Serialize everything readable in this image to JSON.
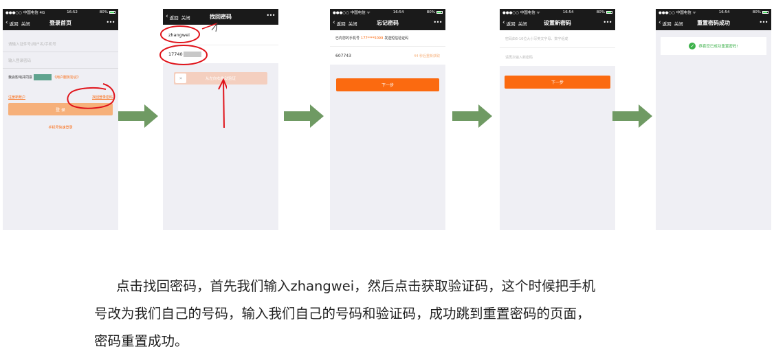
{
  "screens": {
    "login": {
      "status": {
        "carrier": "●●●○○ 中国电信 4G",
        "time": "16:52",
        "right": "80%"
      },
      "nav": {
        "back": "返回",
        "close": "关闭",
        "title": "登录首页",
        "more": "•••"
      },
      "username_placeholder": "请输入证件号/用户名/手机号",
      "password_placeholder": "输入登录密码",
      "agree_text": "我会影响并同意",
      "agree_link": "《用户服务协议》",
      "register_link": "注册新账户",
      "forgot_link": "找回登录密码",
      "login_button": "登 录",
      "quick_login": "手机号快速登录"
    },
    "find": {
      "nav": {
        "back": "返回",
        "close": "关闭",
        "title": "找回密码",
        "more": "•••"
      },
      "username_value": "zhangwei",
      "phone_value": "17740",
      "slider_label": "从左向右拖动验证",
      "slider_handle": "»"
    },
    "forget": {
      "status": {
        "carrier": "●●●○○ 中国电信 ᯤ",
        "time": "16:54",
        "right": "80%"
      },
      "nav": {
        "back": "返回",
        "close": "关闭",
        "title": "忘记密码",
        "more": "•••"
      },
      "sent_prefix": "已向您的手机号",
      "sent_phone": "177****5099",
      "sent_suffix": "发送短信验证码",
      "code_value": "607743",
      "resend": "44 秒后重新获取",
      "next_button": "下一步"
    },
    "setpwd": {
      "status": {
        "carrier": "●●●○○ 中国电信 ᯤ",
        "time": "16:54",
        "right": "80%"
      },
      "nav": {
        "back": "返回",
        "close": "关闭",
        "title": "设置新密码",
        "more": "•••"
      },
      "pwd_placeholder": "密码由6-16位大小写英文字母、数字组成",
      "confirm_placeholder": "请再次输入新密码",
      "next_button": "下一步"
    },
    "success": {
      "status": {
        "carrier": "●●●○○ 中国电信 ᯤ",
        "time": "16:54",
        "right": "80%"
      },
      "nav": {
        "back": "返回",
        "close": "关闭",
        "title": "重置密码成功",
        "more": "•••"
      },
      "message": "恭喜您已成功重置密码!"
    }
  },
  "caption": {
    "line1": "点击找回密码，首先我们输入zhangwei，然后点击获取验证码，这个时候把手机",
    "line2": "号改为我们自己的号码，输入我们自己的号码和验证码，成功跳到重置密码的页面，",
    "line3": "密码重置成功。"
  },
  "colors": {
    "accent_orange": "#fb6a10",
    "accent_orange_light": "#f6b07a",
    "arrow_green": "#6f9a63",
    "success_green": "#3cb14a",
    "annotation_red": "#e0141b"
  }
}
